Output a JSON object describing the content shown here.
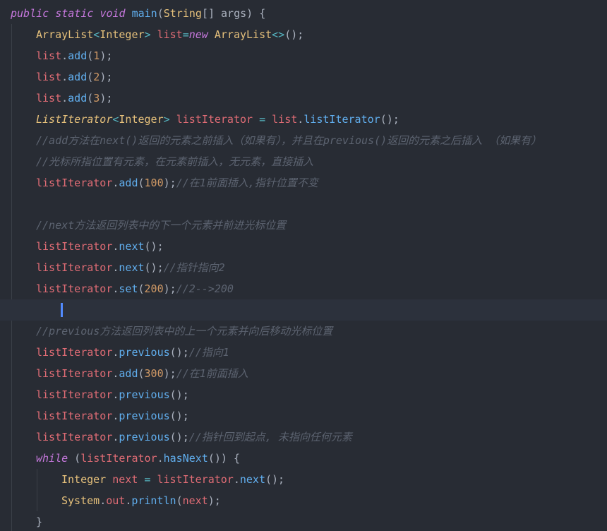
{
  "editor": {
    "language": "java",
    "colors": {
      "background": "#282c34",
      "current_line": "#2c313c",
      "indent_guide": "#3b4048",
      "caret": "#528bff",
      "keyword": "#c678dd",
      "type": "#e5c07b",
      "function": "#61afef",
      "variable": "#e06c75",
      "plain": "#abb2bf",
      "number": "#d19a66",
      "operator": "#56b6c2",
      "comment": "#5c6370"
    },
    "current_line_index": 14,
    "lines": [
      {
        "indent": 0,
        "tokens": [
          [
            "keyword",
            "public"
          ],
          [
            "plain",
            " "
          ],
          [
            "keyword",
            "static"
          ],
          [
            "plain",
            " "
          ],
          [
            "keyword",
            "void"
          ],
          [
            "plain",
            " "
          ],
          [
            "function",
            "main"
          ],
          [
            "plain",
            "("
          ],
          [
            "type",
            "String"
          ],
          [
            "plain",
            "[] "
          ],
          [
            "param",
            "args"
          ],
          [
            "plain",
            ") {"
          ]
        ]
      },
      {
        "indent": 1,
        "tokens": [
          [
            "type",
            "ArrayList"
          ],
          [
            "operator",
            "<"
          ],
          [
            "type",
            "Integer"
          ],
          [
            "operator",
            ">"
          ],
          [
            "plain",
            " "
          ],
          [
            "variable",
            "list"
          ],
          [
            "operator",
            "="
          ],
          [
            "keyword",
            "new"
          ],
          [
            "plain",
            " "
          ],
          [
            "type",
            "ArrayList"
          ],
          [
            "operator",
            "<>"
          ],
          [
            "plain",
            "();"
          ]
        ]
      },
      {
        "indent": 1,
        "tokens": [
          [
            "variable",
            "list"
          ],
          [
            "plain",
            "."
          ],
          [
            "function",
            "add"
          ],
          [
            "plain",
            "("
          ],
          [
            "number",
            "1"
          ],
          [
            "plain",
            ");"
          ]
        ]
      },
      {
        "indent": 1,
        "tokens": [
          [
            "variable",
            "list"
          ],
          [
            "plain",
            "."
          ],
          [
            "function",
            "add"
          ],
          [
            "plain",
            "("
          ],
          [
            "number",
            "2"
          ],
          [
            "plain",
            ");"
          ]
        ]
      },
      {
        "indent": 1,
        "tokens": [
          [
            "variable",
            "list"
          ],
          [
            "plain",
            "."
          ],
          [
            "function",
            "add"
          ],
          [
            "plain",
            "("
          ],
          [
            "number",
            "3"
          ],
          [
            "plain",
            ");"
          ]
        ]
      },
      {
        "indent": 1,
        "tokens": [
          [
            "type-italic",
            "ListIterator"
          ],
          [
            "operator",
            "<"
          ],
          [
            "type",
            "Integer"
          ],
          [
            "operator",
            ">"
          ],
          [
            "plain",
            " "
          ],
          [
            "variable",
            "listIterator"
          ],
          [
            "plain",
            " "
          ],
          [
            "operator",
            "="
          ],
          [
            "plain",
            " "
          ],
          [
            "variable",
            "list"
          ],
          [
            "plain",
            "."
          ],
          [
            "function",
            "listIterator"
          ],
          [
            "plain",
            "();"
          ]
        ]
      },
      {
        "indent": 1,
        "tokens": [
          [
            "comment",
            "//add方法在next()返回的元素之前插入（如果有），并且在previous()返回的元素之后插入 （如果有）"
          ]
        ]
      },
      {
        "indent": 1,
        "tokens": [
          [
            "comment",
            "//光标所指位置有元素，在元素前插入，无元素，直接插入"
          ]
        ]
      },
      {
        "indent": 1,
        "tokens": [
          [
            "variable",
            "listIterator"
          ],
          [
            "plain",
            "."
          ],
          [
            "function",
            "add"
          ],
          [
            "plain",
            "("
          ],
          [
            "number",
            "100"
          ],
          [
            "plain",
            ");"
          ],
          [
            "comment",
            "//在1前面插入,指针位置不变"
          ]
        ]
      },
      {
        "indent": 1,
        "tokens": []
      },
      {
        "indent": 1,
        "tokens": [
          [
            "comment",
            "//next方法返回列表中的下一个元素并前进光标位置"
          ]
        ]
      },
      {
        "indent": 1,
        "tokens": [
          [
            "variable",
            "listIterator"
          ],
          [
            "plain",
            "."
          ],
          [
            "function",
            "next"
          ],
          [
            "plain",
            "();"
          ]
        ]
      },
      {
        "indent": 1,
        "tokens": [
          [
            "variable",
            "listIterator"
          ],
          [
            "plain",
            "."
          ],
          [
            "function",
            "next"
          ],
          [
            "plain",
            "();"
          ],
          [
            "comment",
            "//指针指向2"
          ]
        ]
      },
      {
        "indent": 1,
        "tokens": [
          [
            "variable",
            "listIterator"
          ],
          [
            "plain",
            "."
          ],
          [
            "function",
            "set"
          ],
          [
            "plain",
            "("
          ],
          [
            "number",
            "200"
          ],
          [
            "plain",
            ");"
          ],
          [
            "comment",
            "//2-->200"
          ]
        ]
      },
      {
        "indent": 1,
        "tokens": []
      },
      {
        "indent": 1,
        "tokens": [
          [
            "comment",
            "//previous方法返回列表中的上一个元素并向后移动光标位置"
          ]
        ]
      },
      {
        "indent": 1,
        "tokens": [
          [
            "variable",
            "listIterator"
          ],
          [
            "plain",
            "."
          ],
          [
            "function",
            "previous"
          ],
          [
            "plain",
            "();"
          ],
          [
            "comment",
            "//指向1"
          ]
        ]
      },
      {
        "indent": 1,
        "tokens": [
          [
            "variable",
            "listIterator"
          ],
          [
            "plain",
            "."
          ],
          [
            "function",
            "add"
          ],
          [
            "plain",
            "("
          ],
          [
            "number",
            "300"
          ],
          [
            "plain",
            ");"
          ],
          [
            "comment",
            "//在1前面插入"
          ]
        ]
      },
      {
        "indent": 1,
        "tokens": [
          [
            "variable",
            "listIterator"
          ],
          [
            "plain",
            "."
          ],
          [
            "function",
            "previous"
          ],
          [
            "plain",
            "();"
          ]
        ]
      },
      {
        "indent": 1,
        "tokens": [
          [
            "variable",
            "listIterator"
          ],
          [
            "plain",
            "."
          ],
          [
            "function",
            "previous"
          ],
          [
            "plain",
            "();"
          ]
        ]
      },
      {
        "indent": 1,
        "tokens": [
          [
            "variable",
            "listIterator"
          ],
          [
            "plain",
            "."
          ],
          [
            "function",
            "previous"
          ],
          [
            "plain",
            "();"
          ],
          [
            "comment",
            "//指针回到起点, 未指向任何元素"
          ]
        ]
      },
      {
        "indent": 1,
        "tokens": [
          [
            "keyword",
            "while"
          ],
          [
            "plain",
            " ("
          ],
          [
            "variable",
            "listIterator"
          ],
          [
            "plain",
            "."
          ],
          [
            "function",
            "hasNext"
          ],
          [
            "plain",
            "()) {"
          ]
        ]
      },
      {
        "indent": 2,
        "tokens": [
          [
            "type",
            "Integer"
          ],
          [
            "plain",
            " "
          ],
          [
            "variable",
            "next"
          ],
          [
            "plain",
            " "
          ],
          [
            "operator",
            "="
          ],
          [
            "plain",
            " "
          ],
          [
            "variable",
            "listIterator"
          ],
          [
            "plain",
            "."
          ],
          [
            "function",
            "next"
          ],
          [
            "plain",
            "();"
          ]
        ]
      },
      {
        "indent": 2,
        "tokens": [
          [
            "type",
            "System"
          ],
          [
            "plain",
            "."
          ],
          [
            "variable",
            "out"
          ],
          [
            "plain",
            "."
          ],
          [
            "function",
            "println"
          ],
          [
            "plain",
            "("
          ],
          [
            "variable",
            "next"
          ],
          [
            "plain",
            ");"
          ]
        ]
      },
      {
        "indent": 1,
        "tokens": [
          [
            "plain",
            "}"
          ]
        ]
      }
    ]
  }
}
